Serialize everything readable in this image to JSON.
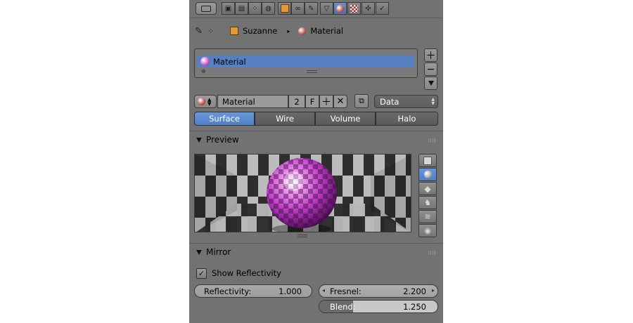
{
  "toolbar": {
    "tool_icons": [
      "render-icon",
      "render-layers-icon",
      "scene-icon",
      "world-icon",
      "object-icon",
      "constraints-icon",
      "modifiers-icon",
      "object-data-icon",
      "material-icon",
      "texture-icon",
      "particles-icon",
      "physics-icon"
    ],
    "active_icon": "material-icon"
  },
  "breadcrumb": {
    "object": "Suzanne",
    "material": "Material"
  },
  "slots": {
    "items": [
      {
        "label": "Material"
      }
    ]
  },
  "datablock": {
    "name": "Material",
    "users": "2",
    "fake_user": "F",
    "link": "Data"
  },
  "tabs": [
    {
      "label": "Surface",
      "selected": true
    },
    {
      "label": "Wire",
      "selected": false
    },
    {
      "label": "Volume",
      "selected": false
    },
    {
      "label": "Halo",
      "selected": false
    }
  ],
  "preview": {
    "title": "Preview",
    "shapes": [
      "plane-icon",
      "sphere-icon",
      "cube-icon",
      "monkey-icon",
      "hair-icon",
      "sphere-sky-icon"
    ],
    "active_shape": "sphere-icon"
  },
  "mirror": {
    "title": "Mirror",
    "show_reflectivity_label": "Show Reflectivity",
    "show_reflectivity_checked": true,
    "reflectivity_label": "Reflectivity:",
    "reflectivity_value": "1.000",
    "fresnel_label": "Fresnel:",
    "fresnel_value": "2.200",
    "blend_label": "Blend:",
    "blend_value": "1.250"
  },
  "colors": {
    "panel_bg": "#727272",
    "selected_blue": "#5680c2",
    "material_purple": "#c040c8"
  }
}
